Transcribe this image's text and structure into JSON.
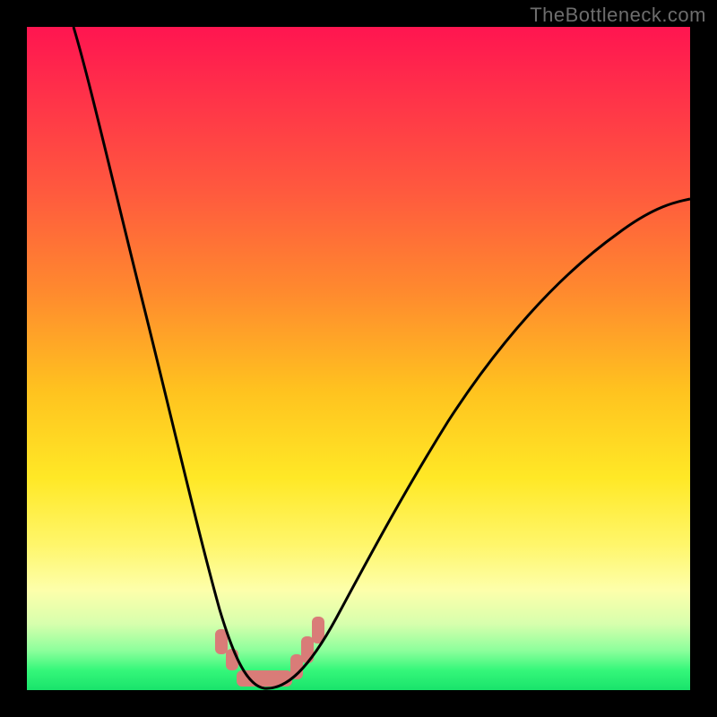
{
  "watermark": "TheBottleneck.com",
  "colors": {
    "frame": "#000000",
    "watermark_text": "#6d6d6d",
    "curve_stroke": "#000000",
    "salmon": "#d97c78",
    "gradient_stops": [
      "#ff1550",
      "#ff2b4b",
      "#ff5a3e",
      "#ff8a2e",
      "#ffc31f",
      "#ffe826",
      "#fff66a",
      "#fdffab",
      "#d7ffad",
      "#8dff9c",
      "#35f77a",
      "#19e36b"
    ]
  },
  "chart_data": {
    "type": "line",
    "title": "",
    "xlabel": "",
    "ylabel": "",
    "x_range": [
      0,
      100
    ],
    "y_range": [
      0,
      100
    ],
    "grid": false,
    "legend": false,
    "series": [
      {
        "name": "bottleneck-curve",
        "x": [
          7,
          10,
          13,
          16,
          19,
          22,
          25,
          27,
          29,
          31,
          33,
          34,
          35,
          37,
          40,
          43,
          46,
          50,
          55,
          60,
          66,
          73,
          80,
          88,
          96,
          100
        ],
        "y": [
          100,
          88,
          76,
          64,
          53,
          42,
          32,
          24,
          17,
          11,
          6,
          3,
          1,
          0,
          0,
          1,
          4,
          9,
          16,
          24,
          33,
          43,
          53,
          62,
          70,
          74
        ]
      }
    ],
    "annotations": [
      {
        "name": "minimum-band",
        "x_start": 34,
        "x_end": 43,
        "y_approx": 0
      }
    ],
    "background_gradient": {
      "direction": "vertical",
      "meaning": "red (top) = high bottleneck, green (bottom) = low bottleneck"
    }
  }
}
